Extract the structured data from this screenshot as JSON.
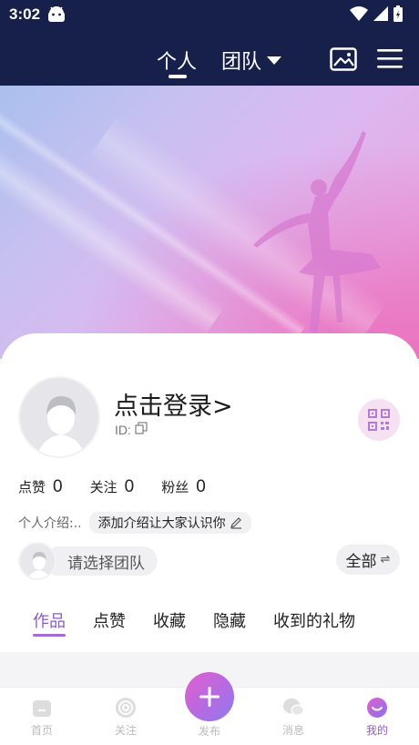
{
  "status_bar": {
    "time": "3:02"
  },
  "top_nav": {
    "tabs": [
      {
        "label": "个人",
        "active": true
      },
      {
        "label": "团队",
        "active": false
      }
    ]
  },
  "profile": {
    "login_text": "点击登录>",
    "id_label": "ID:",
    "stats": [
      {
        "label": "点赞",
        "value": "0"
      },
      {
        "label": "关注",
        "value": "0"
      },
      {
        "label": "粉丝",
        "value": "0"
      }
    ],
    "intro_label": "个人介绍:..",
    "intro_placeholder": "添加介绍让大家认识你"
  },
  "team": {
    "select_placeholder": "请选择团队",
    "filter_label": "全部",
    "filter_icon": "⇌"
  },
  "content_tabs": [
    {
      "label": "作品",
      "active": true
    },
    {
      "label": "点赞",
      "active": false
    },
    {
      "label": "收藏",
      "active": false
    },
    {
      "label": "隐藏",
      "active": false
    },
    {
      "label": "收到的礼物",
      "active": false
    }
  ],
  "bottom_nav": {
    "items": [
      {
        "label": "首页",
        "icon": "home-icon"
      },
      {
        "label": "关注",
        "icon": "follow-icon"
      },
      {
        "label": "发布",
        "icon": "plus-icon"
      },
      {
        "label": "消息",
        "icon": "message-icon"
      },
      {
        "label": "我的",
        "icon": "me-icon",
        "active": true
      }
    ]
  },
  "colors": {
    "header_bg": "#16204a",
    "accent": "#9a58d0",
    "publish_gradient_start": "#e25fd0",
    "publish_gradient_end": "#8c7cf0"
  }
}
